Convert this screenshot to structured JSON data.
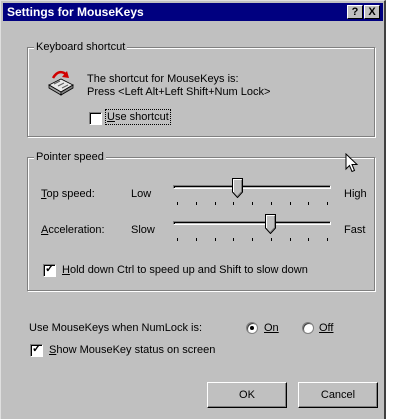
{
  "window": {
    "title": "Settings for MouseKeys",
    "help_button": "?",
    "close_button": "X"
  },
  "keyboard_shortcut": {
    "group_label": "Keyboard shortcut",
    "line1": "The shortcut for MouseKeys is:",
    "line2": "Press <Left Alt+Left Shift+Num Lock>",
    "use_shortcut": {
      "mnemonic": "U",
      "rest": "se shortcut",
      "checked": false
    }
  },
  "pointer_speed": {
    "group_label": "Pointer speed",
    "top_speed": {
      "mnemonic": "T",
      "rest": "op speed:",
      "low": "Low",
      "high": "High",
      "value": 0.4
    },
    "acceleration": {
      "mnemonic": "A",
      "rest": "cceleration:",
      "low": "Slow",
      "high": "Fast",
      "value": 0.62
    },
    "hold_ctrl": {
      "mnemonic": "H",
      "rest": "old down Ctrl to speed up and Shift to slow down",
      "checked": true
    }
  },
  "numlock": {
    "label": "Use MouseKeys when NumLock is:",
    "on": {
      "text": "On",
      "selected": true
    },
    "off": {
      "text": "Off",
      "selected": false
    }
  },
  "show_status": {
    "mnemonic": "S",
    "rest": "how MouseKey status on screen",
    "checked": true
  },
  "buttons": {
    "ok": "OK",
    "cancel": "Cancel"
  }
}
